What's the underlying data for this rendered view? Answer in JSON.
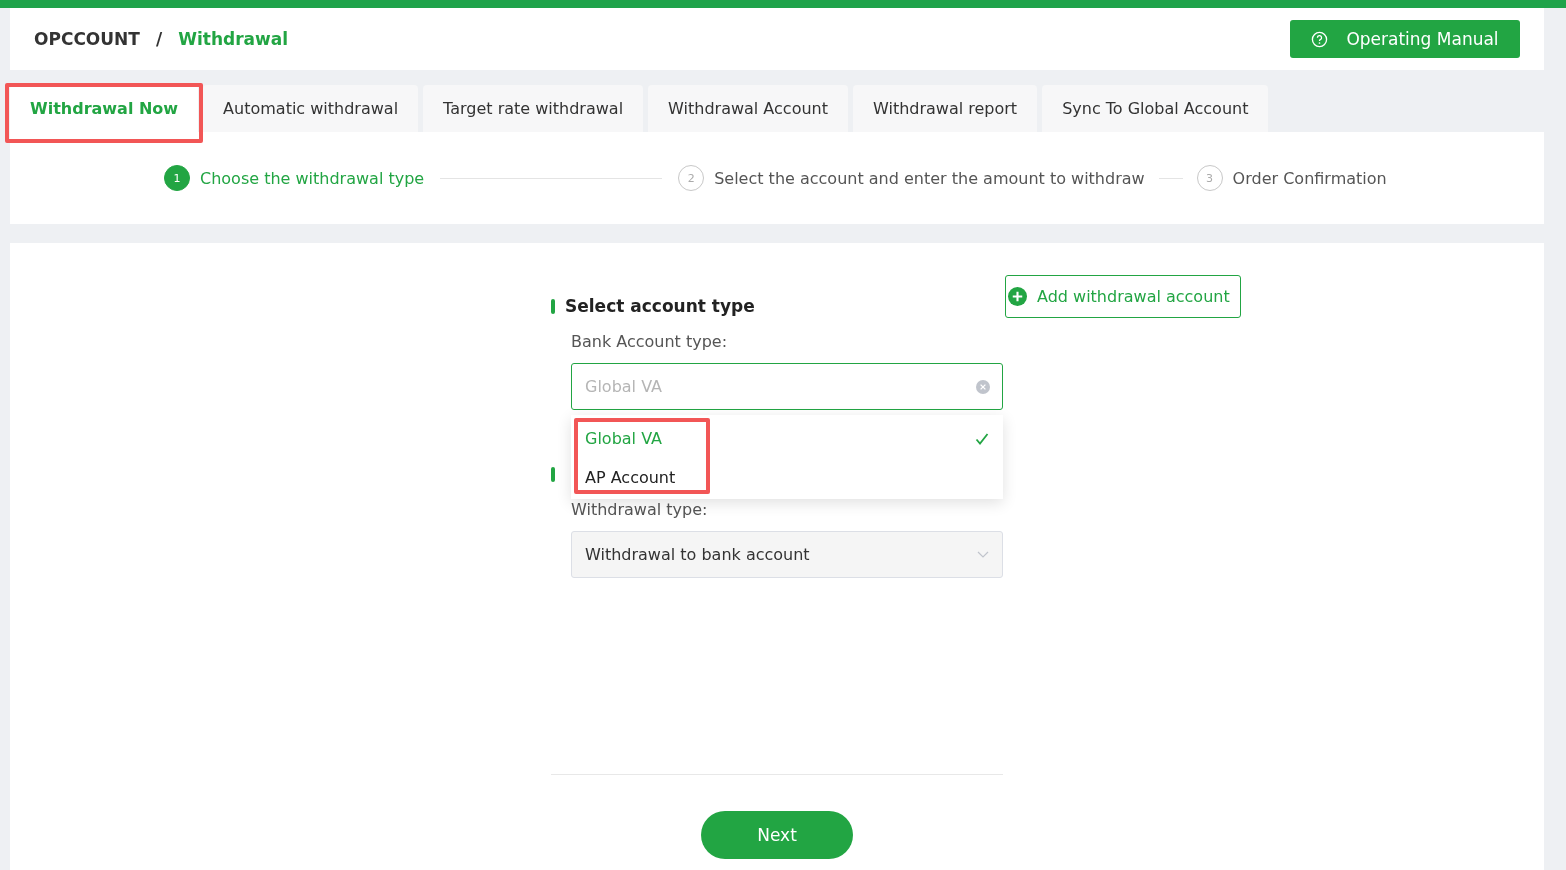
{
  "breadcrumb": [
    {
      "label": "OPCCOUNT",
      "current": false
    },
    {
      "label": "Withdrawal",
      "current": true
    }
  ],
  "breadcrumb_separator": "/",
  "manual_button": "Operating Manual",
  "tabs": [
    {
      "label": "Withdrawal Now",
      "selected": true,
      "highlighted": true
    },
    {
      "label": "Automatic withdrawal",
      "selected": false,
      "highlighted": false
    },
    {
      "label": "Target rate withdrawal",
      "selected": false,
      "highlighted": false
    },
    {
      "label": "Withdrawal Account",
      "selected": false,
      "highlighted": false
    },
    {
      "label": "Withdrawal report",
      "selected": false,
      "highlighted": false
    },
    {
      "label": "Sync To Global Account",
      "selected": false,
      "highlighted": false
    }
  ],
  "steps": [
    {
      "number": "1",
      "label": "Choose the withdrawal type",
      "active": true
    },
    {
      "number": "2",
      "label": "Select the account and enter the amount to withdraw",
      "active": false
    },
    {
      "number": "3",
      "label": "Order Confirmation",
      "active": false
    }
  ],
  "add_account_button": "Add withdrawal account",
  "sections": [
    {
      "title": "Select account type",
      "label": "Bank Account type:",
      "field": {
        "kind": "clearable",
        "placeholder": "Global VA",
        "open": true,
        "options": [
          {
            "label": "Global VA",
            "selected": true
          },
          {
            "label": "AP Account",
            "selected": false
          }
        ],
        "options_highlighted": true
      }
    },
    {
      "label": "Withdrawal type:",
      "field": {
        "kind": "dropdown",
        "value": "Withdrawal to bank account"
      }
    }
  ],
  "next_button": "Next"
}
